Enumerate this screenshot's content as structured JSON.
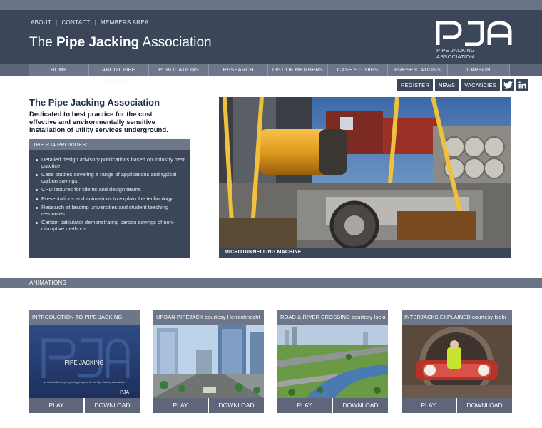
{
  "header": {
    "top_links": [
      "ABOUT",
      "CONTACT",
      "MEMBERS AREA"
    ],
    "title_prefix": "The",
    "title_bold": "Pipe Jacking",
    "title_suffix": "Association",
    "logo_sub": "PIPE JACKING ASSOCIATION"
  },
  "nav": [
    {
      "label": "HOME",
      "key": "home"
    },
    {
      "label": "ABOUT PIPE JACKING",
      "key": "about"
    },
    {
      "label": "PUBLICATIONS",
      "key": "publications"
    },
    {
      "label": "RESEARCH",
      "key": "research"
    },
    {
      "label": "LIST OF MEMBERS",
      "key": "members"
    },
    {
      "label": "CASE STUDIES",
      "key": "case-studies"
    },
    {
      "label": "PRESENTATIONS",
      "key": "presentations"
    },
    {
      "label": "CARBON CALCULATOR",
      "key": "carbon"
    }
  ],
  "utility": {
    "register": "REGISTER",
    "news": "NEWS",
    "vacancies": "VACANCIES",
    "twitter_icon": "twitter-icon",
    "linkedin_icon": "linkedin-icon"
  },
  "intro": {
    "title": "The Pipe Jacking Association",
    "text": "Dedicated to best practice for the cost effective and environmentally sensitive installation of utility services underground."
  },
  "provides": {
    "heading": "THE PJA PROVIDES:",
    "items": [
      "Detailed design advisory publications based on industry best practice",
      "Case studies covering a range of applications and typical carbon savings",
      "CPD lectures for clients and design teams",
      "Presentations and animations to explain the technology",
      "Research at leading universities and student teaching resources",
      "Carbon calculator demonstrating carbon savings of non-disruptive methods"
    ]
  },
  "hero": {
    "caption": "MICROTUNNELLING MACHINE"
  },
  "animations": {
    "heading": "ANIMATIONS",
    "cards": [
      {
        "title": "INTRODUCTION TO PIPE JACKING",
        "play": "PLAY",
        "download": "DOWNLOAD",
        "thumb_title": "PIPE JACKING",
        "thumb_sub": "An introduction to pipe jacking prepared by the Pipe Jacking Association",
        "thumb_logo": "PJA"
      },
      {
        "title": "URBAN PIPEJACK courtesy Herrenknecht",
        "play": "PLAY",
        "download": "DOWNLOAD"
      },
      {
        "title": "ROAD & RIVER CROSSING courtesy Iseki",
        "play": "PLAY",
        "download": "DOWNLOAD"
      },
      {
        "title": "INTERJACKS EXPLAINED courtesy Iseki",
        "play": "PLAY",
        "download": "DOWNLOAD"
      }
    ]
  },
  "colors": {
    "dark_navy": "#3c4659",
    "slate": "#6e7789",
    "title_text": "#1e2d4a"
  }
}
